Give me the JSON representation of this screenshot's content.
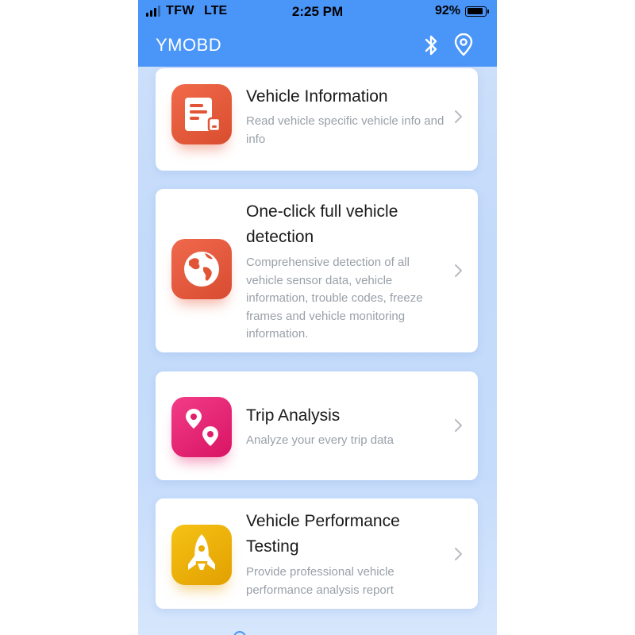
{
  "status_bar": {
    "carrier": "TFW",
    "network": "LTE",
    "time": "2:25 PM",
    "battery_percent": "92%",
    "battery_level": 0.92,
    "signal_bars": 4,
    "signal_bars_active": 3
  },
  "header": {
    "title": "YMOBD",
    "icons": [
      "bluetooth-icon",
      "location-pin-icon"
    ]
  },
  "menu": {
    "items": [
      {
        "title": "Vehicle Information",
        "description": "Read vehicle specific vehicle info and info",
        "icon": "document-icon",
        "icon_color": "#e45a3b"
      },
      {
        "title": "One-click full vehicle detection",
        "description": "Comprehensive detection of all vehicle sensor data, vehicle information, trouble codes, freeze frames and vehicle monitoring information.",
        "icon": "globe-icon",
        "icon_color": "#e45a3b"
      },
      {
        "title": "Trip Analysis",
        "description": "Analyze your every trip data",
        "icon": "map-pins-icon",
        "icon_color": "#e8287a"
      },
      {
        "title": "Vehicle Performance Testing",
        "description": "Provide professional vehicle performance analysis report",
        "icon": "rocket-icon",
        "icon_color": "#efb10a"
      }
    ]
  },
  "colors": {
    "accent": "#4a95f8",
    "background": "#c6dcfb",
    "card": "#ffffff",
    "title_text": "#1a1a1a",
    "description_text": "#9aa0a8"
  }
}
